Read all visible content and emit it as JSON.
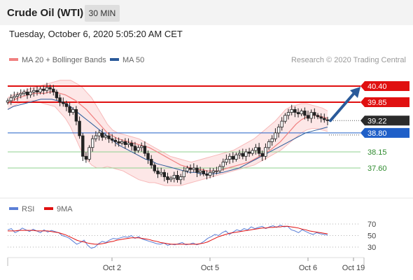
{
  "header": {
    "title": "Crude Oil (WTI)",
    "timeframe": "30 MIN"
  },
  "datetime": "Tuesday, October 6, 2020 5:05:20 AM CET",
  "legend": {
    "items": [
      {
        "label": "MA 20 + Bollinger Bands",
        "color": "#f08080"
      },
      {
        "label": "MA 50",
        "color": "#2a5a9a"
      }
    ],
    "credit": "Research © 2020 Trading Central"
  },
  "rsi_legend": {
    "items": [
      {
        "label": "RSI",
        "color": "#5b7fd6"
      },
      {
        "label": "9MA",
        "color": "#e01010"
      }
    ]
  },
  "chart_data": {
    "type": "candlestick",
    "instrument": "Crude Oil (WTI)",
    "timeframe": "30 MIN",
    "ylim": [
      37.0,
      41.0
    ],
    "x_ticks": [
      "Oct 2",
      "Oct 5",
      "Oct 6",
      "Oct 19"
    ],
    "levels": [
      {
        "value": 40.4,
        "label": "40.40",
        "kind": "resistance",
        "color": "#e01010"
      },
      {
        "value": 39.85,
        "label": "39.85",
        "kind": "resistance",
        "color": "#e01010"
      },
      {
        "value": 39.22,
        "label": "39.22",
        "kind": "current",
        "color": "#333333"
      },
      {
        "value": 38.8,
        "label": "38.80",
        "kind": "pivot",
        "color": "#1f5fc8"
      },
      {
        "value": 38.15,
        "label": "38.15",
        "kind": "support",
        "color": "#2e8b2e"
      },
      {
        "value": 37.6,
        "label": "37.60",
        "kind": "support",
        "color": "#2e8b2e"
      }
    ],
    "closes": [
      39.9,
      40.0,
      40.05,
      40.1,
      40.15,
      40.2,
      40.1,
      40.2,
      40.25,
      40.2,
      40.3,
      40.25,
      40.35,
      40.3,
      40.2,
      40.0,
      39.85,
      39.8,
      39.7,
      39.5,
      39.6,
      39.2,
      38.7,
      38.0,
      37.9,
      38.3,
      38.6,
      38.7,
      38.8,
      38.65,
      38.7,
      38.6,
      38.55,
      38.5,
      38.45,
      38.5,
      38.4,
      38.45,
      38.35,
      38.2,
      38.3,
      38.35,
      38.1,
      37.9,
      37.7,
      37.5,
      37.4,
      37.45,
      37.3,
      37.2,
      37.25,
      37.35,
      37.2,
      37.3,
      37.5,
      37.6,
      37.55,
      37.6,
      37.45,
      37.5,
      37.4,
      37.35,
      37.45,
      37.5,
      37.5,
      37.65,
      37.8,
      37.9,
      38.0,
      37.9,
      38.05,
      38.1,
      38.0,
      38.15,
      38.1,
      38.2,
      38.3,
      38.1,
      38.0,
      38.3,
      38.5,
      38.6,
      38.8,
      39.0,
      39.2,
      39.4,
      39.5,
      39.6,
      39.5,
      39.45,
      39.55,
      39.4,
      39.3,
      39.5,
      39.4,
      39.35,
      39.3,
      39.25,
      39.22
    ],
    "ma20": [
      39.8,
      39.9,
      40.0,
      40.05,
      40.1,
      40.15,
      40.15,
      40.15,
      40.2,
      40.2,
      40.15,
      40.1,
      40.0,
      39.9,
      39.75,
      39.6,
      39.4,
      39.2,
      39.0,
      38.8,
      38.7,
      38.6,
      38.55,
      38.5,
      38.45,
      38.4,
      38.35,
      38.3,
      38.2,
      38.1,
      38.0,
      37.9,
      37.8,
      37.7,
      37.65,
      37.6,
      37.55,
      37.55,
      37.5,
      37.5,
      37.5,
      37.55,
      37.6,
      37.65,
      37.7,
      37.75,
      37.8,
      37.9,
      38.0,
      38.1,
      38.2,
      38.35,
      38.5,
      38.7,
      38.9,
      39.1,
      39.25,
      39.35,
      39.4,
      39.4,
      39.35,
      39.3
    ],
    "bollinger_upper": [
      40.0,
      40.1,
      40.15,
      40.2,
      40.3,
      40.35,
      40.4,
      40.45,
      40.5,
      40.55,
      40.6,
      40.6,
      40.6,
      40.5,
      40.4,
      40.2,
      40.0,
      39.7,
      39.4,
      39.1,
      38.9,
      38.8,
      38.75,
      38.7,
      38.65,
      38.6,
      38.5,
      38.4,
      38.3,
      38.2,
      38.1,
      38.0,
      37.95,
      37.9,
      37.85,
      37.8,
      37.85,
      37.9,
      37.95,
      38.0,
      38.05,
      38.1,
      38.15,
      38.2,
      38.3,
      38.4,
      38.5,
      38.6,
      38.75,
      38.9,
      39.05,
      39.2,
      39.4,
      39.6,
      39.7,
      39.75,
      39.8,
      39.8,
      39.75,
      39.7,
      39.65,
      39.55
    ],
    "bollinger_lower": [
      39.6,
      39.7,
      39.8,
      39.85,
      39.9,
      39.9,
      39.85,
      39.8,
      39.75,
      39.7,
      39.5,
      39.3,
      39.0,
      38.6,
      38.2,
      37.9,
      37.7,
      37.6,
      37.6,
      37.65,
      37.6,
      37.55,
      37.5,
      37.4,
      37.3,
      37.2,
      37.15,
      37.1,
      37.1,
      37.05,
      37.0,
      37.0,
      37.0,
      37.0,
      37.05,
      37.1,
      37.15,
      37.2,
      37.25,
      37.3,
      37.35,
      37.4,
      37.45,
      37.5,
      37.55,
      37.6,
      37.65,
      37.7,
      37.8,
      37.9,
      38.0,
      38.1,
      38.2,
      38.35,
      38.5,
      38.65,
      38.8,
      38.9,
      38.95,
      38.95,
      38.9,
      38.85
    ],
    "ma50": [
      39.6,
      39.7,
      39.75,
      39.8,
      39.85,
      39.9,
      39.95,
      39.95,
      39.95,
      39.9,
      39.85,
      39.75,
      39.6,
      39.45,
      39.3,
      39.15,
      39.0,
      38.85,
      38.7,
      38.55,
      38.4,
      38.3,
      38.2,
      38.1,
      38.0,
      37.9,
      37.85,
      37.75,
      37.7,
      37.65,
      37.6,
      37.55,
      37.5,
      37.45,
      37.45,
      37.4,
      37.4,
      37.4,
      37.42,
      37.45,
      37.5,
      37.55,
      37.6,
      37.7,
      37.8,
      37.9,
      38.0,
      38.1,
      38.2,
      38.3,
      38.4,
      38.5,
      38.6,
      38.7,
      38.8,
      38.85,
      38.9,
      38.95,
      39.0
    ],
    "forecast": {
      "from": 39.22,
      "to": 40.4,
      "direction": "up"
    },
    "rsi": {
      "ylim": [
        0,
        100
      ],
      "levels": [
        70,
        50,
        30
      ],
      "x_ticks": [
        "Oct 2",
        "Oct 5",
        "Oct 6",
        "Oct 19"
      ],
      "rsi_values": [
        60,
        62,
        55,
        58,
        63,
        60,
        57,
        61,
        58,
        55,
        60,
        56,
        59,
        57,
        55,
        50,
        48,
        45,
        40,
        35,
        38,
        42,
        33,
        28,
        30,
        36,
        40,
        38,
        42,
        45,
        44,
        46,
        48,
        47,
        50,
        45,
        48,
        44,
        42,
        40,
        38,
        36,
        35,
        37,
        33,
        35,
        34,
        36,
        38,
        34,
        35,
        37,
        34,
        36,
        40,
        45,
        48,
        52,
        50,
        55,
        58,
        52,
        56,
        60,
        58,
        62,
        60,
        65,
        62,
        64,
        66,
        62,
        65,
        67,
        64,
        68,
        65,
        66,
        60,
        58,
        55,
        60,
        57,
        54,
        52,
        55,
        53,
        52,
        51
      ],
      "ma9_values": [
        58,
        58,
        58,
        59,
        59,
        59,
        59,
        59,
        58,
        58,
        58,
        58,
        57,
        56,
        55,
        53,
        51,
        48,
        45,
        42,
        40,
        39,
        37,
        36,
        35,
        35,
        36,
        37,
        39,
        40,
        42,
        43,
        44,
        45,
        46,
        46,
        46,
        45,
        44,
        43,
        41,
        40,
        38,
        37,
        36,
        35,
        35,
        35,
        35,
        35,
        35,
        35,
        35,
        36,
        37,
        39,
        42,
        45,
        48,
        50,
        52,
        54,
        55,
        56,
        57,
        58,
        59,
        60,
        61,
        62,
        63,
        63,
        64,
        64,
        65,
        65,
        66,
        66,
        65,
        64,
        63,
        61,
        60,
        58,
        57,
        56,
        55,
        54,
        53
      ]
    }
  }
}
